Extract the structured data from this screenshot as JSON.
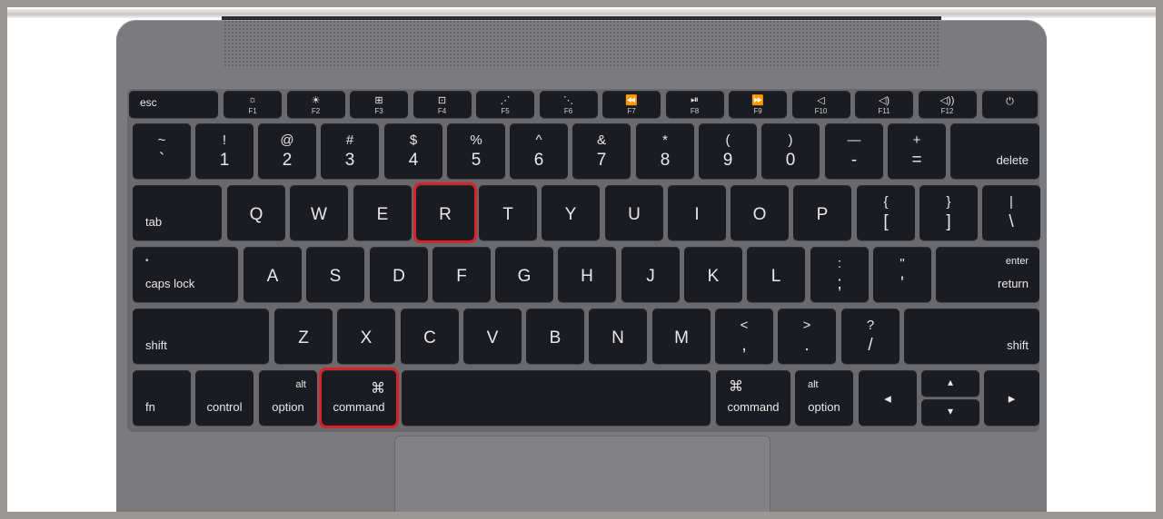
{
  "keyboard": {
    "function_row": [
      {
        "icon": "☼",
        "label": "F1"
      },
      {
        "icon": "☀",
        "label": "F2"
      },
      {
        "icon": "⊞",
        "label": "F3"
      },
      {
        "icon": "⊡",
        "label": "F4"
      },
      {
        "icon": "⋰",
        "label": "F5"
      },
      {
        "icon": "⋱",
        "label": "F6"
      },
      {
        "icon": "⏪",
        "label": "F7"
      },
      {
        "icon": "⏯",
        "label": "F8"
      },
      {
        "icon": "⏩",
        "label": "F9"
      },
      {
        "icon": "◁",
        "label": "F10"
      },
      {
        "icon": "◁)",
        "label": "F11"
      },
      {
        "icon": "◁))",
        "label": "F12"
      }
    ],
    "esc": "esc",
    "power_icon": "⏻",
    "number_row": [
      {
        "top": "~",
        "bottom": "`"
      },
      {
        "top": "!",
        "bottom": "1"
      },
      {
        "top": "@",
        "bottom": "2"
      },
      {
        "top": "#",
        "bottom": "3"
      },
      {
        "top": "$",
        "bottom": "4"
      },
      {
        "top": "%",
        "bottom": "5"
      },
      {
        "top": "^",
        "bottom": "6"
      },
      {
        "top": "&",
        "bottom": "7"
      },
      {
        "top": "*",
        "bottom": "8"
      },
      {
        "top": "(",
        "bottom": "9"
      },
      {
        "top": ")",
        "bottom": "0"
      },
      {
        "top": "—",
        "bottom": "-"
      },
      {
        "top": "+",
        "bottom": "="
      }
    ],
    "delete": "delete",
    "tab": "tab",
    "qwerty_row": [
      "Q",
      "W",
      "E",
      "R",
      "T",
      "Y",
      "U",
      "I",
      "O",
      "P"
    ],
    "bracket_keys": [
      {
        "top": "{",
        "bottom": "["
      },
      {
        "top": "}",
        "bottom": "]"
      },
      {
        "top": "|",
        "bottom": "\\"
      }
    ],
    "caps_dot": "•",
    "caps_lock": "caps lock",
    "home_row": [
      "A",
      "S",
      "D",
      "F",
      "G",
      "H",
      "J",
      "K",
      "L"
    ],
    "semicolon_key": {
      "top": ":",
      "bottom": ";"
    },
    "quote_key": {
      "top": "\"",
      "bottom": "'"
    },
    "enter": "enter",
    "return": "return",
    "shift_left": "shift",
    "bottom_row_letters": [
      "Z",
      "X",
      "C",
      "V",
      "B",
      "N",
      "M"
    ],
    "punct_keys": [
      {
        "top": "<",
        "bottom": ","
      },
      {
        "top": ">",
        "bottom": "."
      },
      {
        "top": "?",
        "bottom": "/"
      }
    ],
    "shift_right": "shift",
    "fn": "fn",
    "control": "control",
    "option_left": {
      "top": "alt",
      "bottom": "option"
    },
    "command_left": {
      "symbol": "⌘",
      "label": "command"
    },
    "command_right": {
      "symbol": "⌘",
      "label": "command"
    },
    "option_right": {
      "top": "alt",
      "bottom": "option"
    },
    "arrows": {
      "left": "◂",
      "up": "▴",
      "down": "▾",
      "right": "▸"
    }
  },
  "highlighted_keys": [
    "R",
    "command"
  ],
  "highlight_color": "#d82128"
}
